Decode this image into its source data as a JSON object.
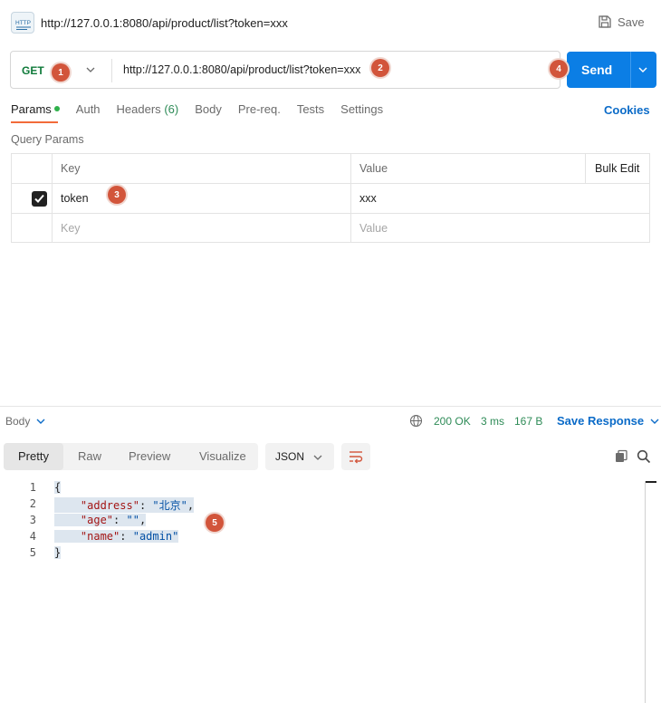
{
  "titlebar": {
    "icon": "http-icon",
    "icon_text": "HTTP",
    "url": "http://127.0.0.1:8080/api/product/list?token=xxx",
    "save_label": "Save"
  },
  "request": {
    "method": "GET",
    "url": "http://127.0.0.1:8080/api/product/list?token=xxx",
    "send_label": "Send"
  },
  "badges": [
    "1",
    "2",
    "3",
    "4",
    "5"
  ],
  "tabs": [
    {
      "label": "Params",
      "active": true,
      "dot": true
    },
    {
      "label": "Auth"
    },
    {
      "label": "Headers",
      "count": "(6)"
    },
    {
      "label": "Body"
    },
    {
      "label": "Pre-req."
    },
    {
      "label": "Tests"
    },
    {
      "label": "Settings"
    }
  ],
  "cookies_label": "Cookies",
  "query_params": {
    "title": "Query Params",
    "headers": {
      "key": "Key",
      "value": "Value",
      "bulk": "Bulk Edit"
    },
    "rows": [
      {
        "checked": true,
        "key": "token",
        "value": "xxx"
      }
    ],
    "placeholder_key": "Key",
    "placeholder_value": "Value"
  },
  "response": {
    "body_label": "Body",
    "status": "200 OK",
    "time": "3 ms",
    "size": "167 B",
    "save_response_label": "Save Response",
    "view_modes": [
      "Pretty",
      "Raw",
      "Preview",
      "Visualize"
    ],
    "active_view": "Pretty",
    "format": "JSON",
    "lines": [
      {
        "n": "1",
        "text": "{"
      },
      {
        "n": "2",
        "key": "\"address\"",
        "sep": ": ",
        "val": "\"北京\"",
        "end": ","
      },
      {
        "n": "3",
        "key": "\"age\"",
        "sep": ": ",
        "val": "\"\"",
        "end": ","
      },
      {
        "n": "4",
        "key": "\"name\"",
        "sep": ": ",
        "val": "\"admin\"",
        "end": ""
      },
      {
        "n": "5",
        "text": "}"
      }
    ]
  },
  "colors": {
    "accent": "#0b7ee5",
    "method": "#0f7a3a",
    "badge": "#d2553b",
    "status": "#2e8b57"
  }
}
